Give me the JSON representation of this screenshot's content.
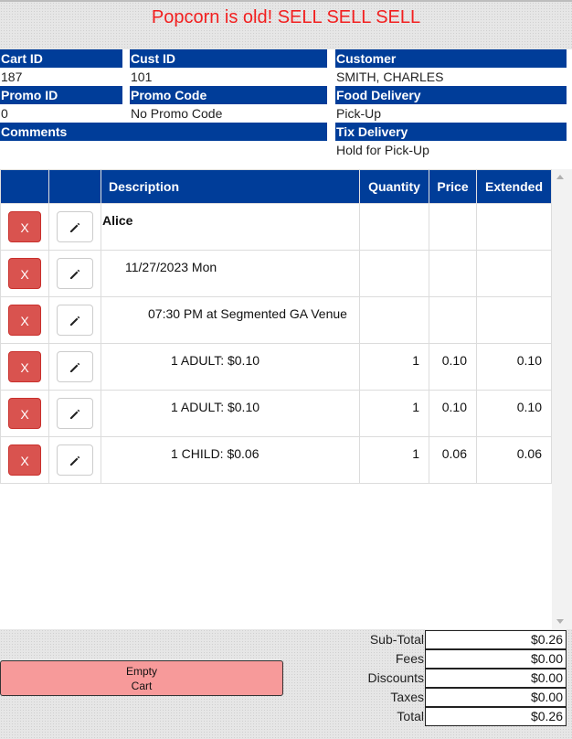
{
  "banner": {
    "text": "Popcorn is old! SELL SELL SELL",
    "color": "#f21f1f"
  },
  "info": {
    "cart_id_label": "Cart ID",
    "cart_id": "187",
    "cust_id_label": "Cust ID",
    "cust_id": "101",
    "customer_label": "Customer",
    "customer": "SMITH, CHARLES",
    "promo_id_label": "Promo ID",
    "promo_id": "0",
    "promo_code_label": "Promo Code",
    "promo_code": "No Promo Code",
    "food_delivery_label": "Food Delivery",
    "food_delivery": "Pick-Up",
    "comments_label": "Comments",
    "tix_delivery_label": "Tix Delivery",
    "tix_delivery": "Hold for Pick-Up"
  },
  "table": {
    "columns": {
      "description": "Description",
      "quantity": "Quantity",
      "price": "Price",
      "extended": "Extended"
    },
    "remove_label": "X",
    "rows": [
      {
        "description": "Alice",
        "quantity": "",
        "price": "",
        "extended": ""
      },
      {
        "description": "11/27/2023 Mon",
        "quantity": "",
        "price": "",
        "extended": ""
      },
      {
        "description": "07:30 PM at Segmented GA Venue",
        "quantity": "",
        "price": "",
        "extended": ""
      },
      {
        "description": "1 ADULT: $0.10",
        "quantity": "1",
        "price": "0.10",
        "extended": "0.10"
      },
      {
        "description": "1 ADULT: $0.10",
        "quantity": "1",
        "price": "0.10",
        "extended": "0.10"
      },
      {
        "description": "1 CHILD: $0.06",
        "quantity": "1",
        "price": "0.06",
        "extended": "0.06"
      }
    ]
  },
  "footer": {
    "empty_cart_line1": "Empty",
    "empty_cart_line2": "Cart",
    "totals": [
      {
        "label": "Sub-Total",
        "value": "$0.26"
      },
      {
        "label": "Fees",
        "value": "$0.00"
      },
      {
        "label": "Discounts",
        "value": "$0.00"
      },
      {
        "label": "Taxes",
        "value": "$0.00"
      },
      {
        "label": "Total",
        "value": "$0.26"
      }
    ]
  },
  "colors": {
    "header_blue": "#003d99",
    "remove_red": "#d9534f",
    "empty_cart_pink": "#f79a9a"
  },
  "icons": {
    "edit": "pencil-icon"
  }
}
